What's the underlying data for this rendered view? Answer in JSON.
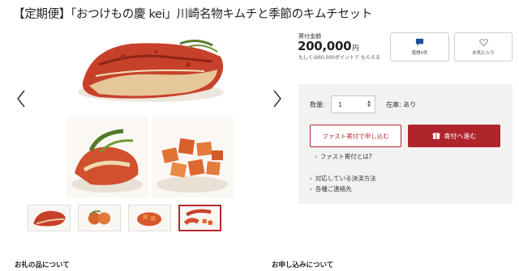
{
  "product": {
    "title": "【定期便】「おつけもの慶 kei」川崎名物キムチと季節のキムチセット"
  },
  "price": {
    "label": "寄付金額",
    "amount": "200,000",
    "unit": "円",
    "points_note": "もしくは60,000ポイントで もらえる"
  },
  "actions": {
    "thanks_label": "感想0件",
    "favorite_label": "お気に入り"
  },
  "order": {
    "quantity_label": "数量:",
    "quantity_value": "1",
    "stock_label": "在庫: あり",
    "fast_button": "ファスト寄付で申し込む",
    "donate_button": "寄付へ進む",
    "fast_link": "ファスト寄付とは?",
    "payment_link": "対応している決済方法",
    "contact_link": "各種ご連絡先"
  },
  "sections": {
    "gift": "お礼の品について",
    "apply": "お申し込みについて"
  },
  "colors": {
    "accent": "#b0242b",
    "link_chevron": "#1c4f9c",
    "panel_bg": "#f2f2f2"
  },
  "icons": {
    "prev": "chevron-left-icon",
    "next": "chevron-right-icon",
    "thanks": "speech-bubble-icon",
    "favorite": "heart-icon",
    "donate": "gift-box-icon"
  }
}
